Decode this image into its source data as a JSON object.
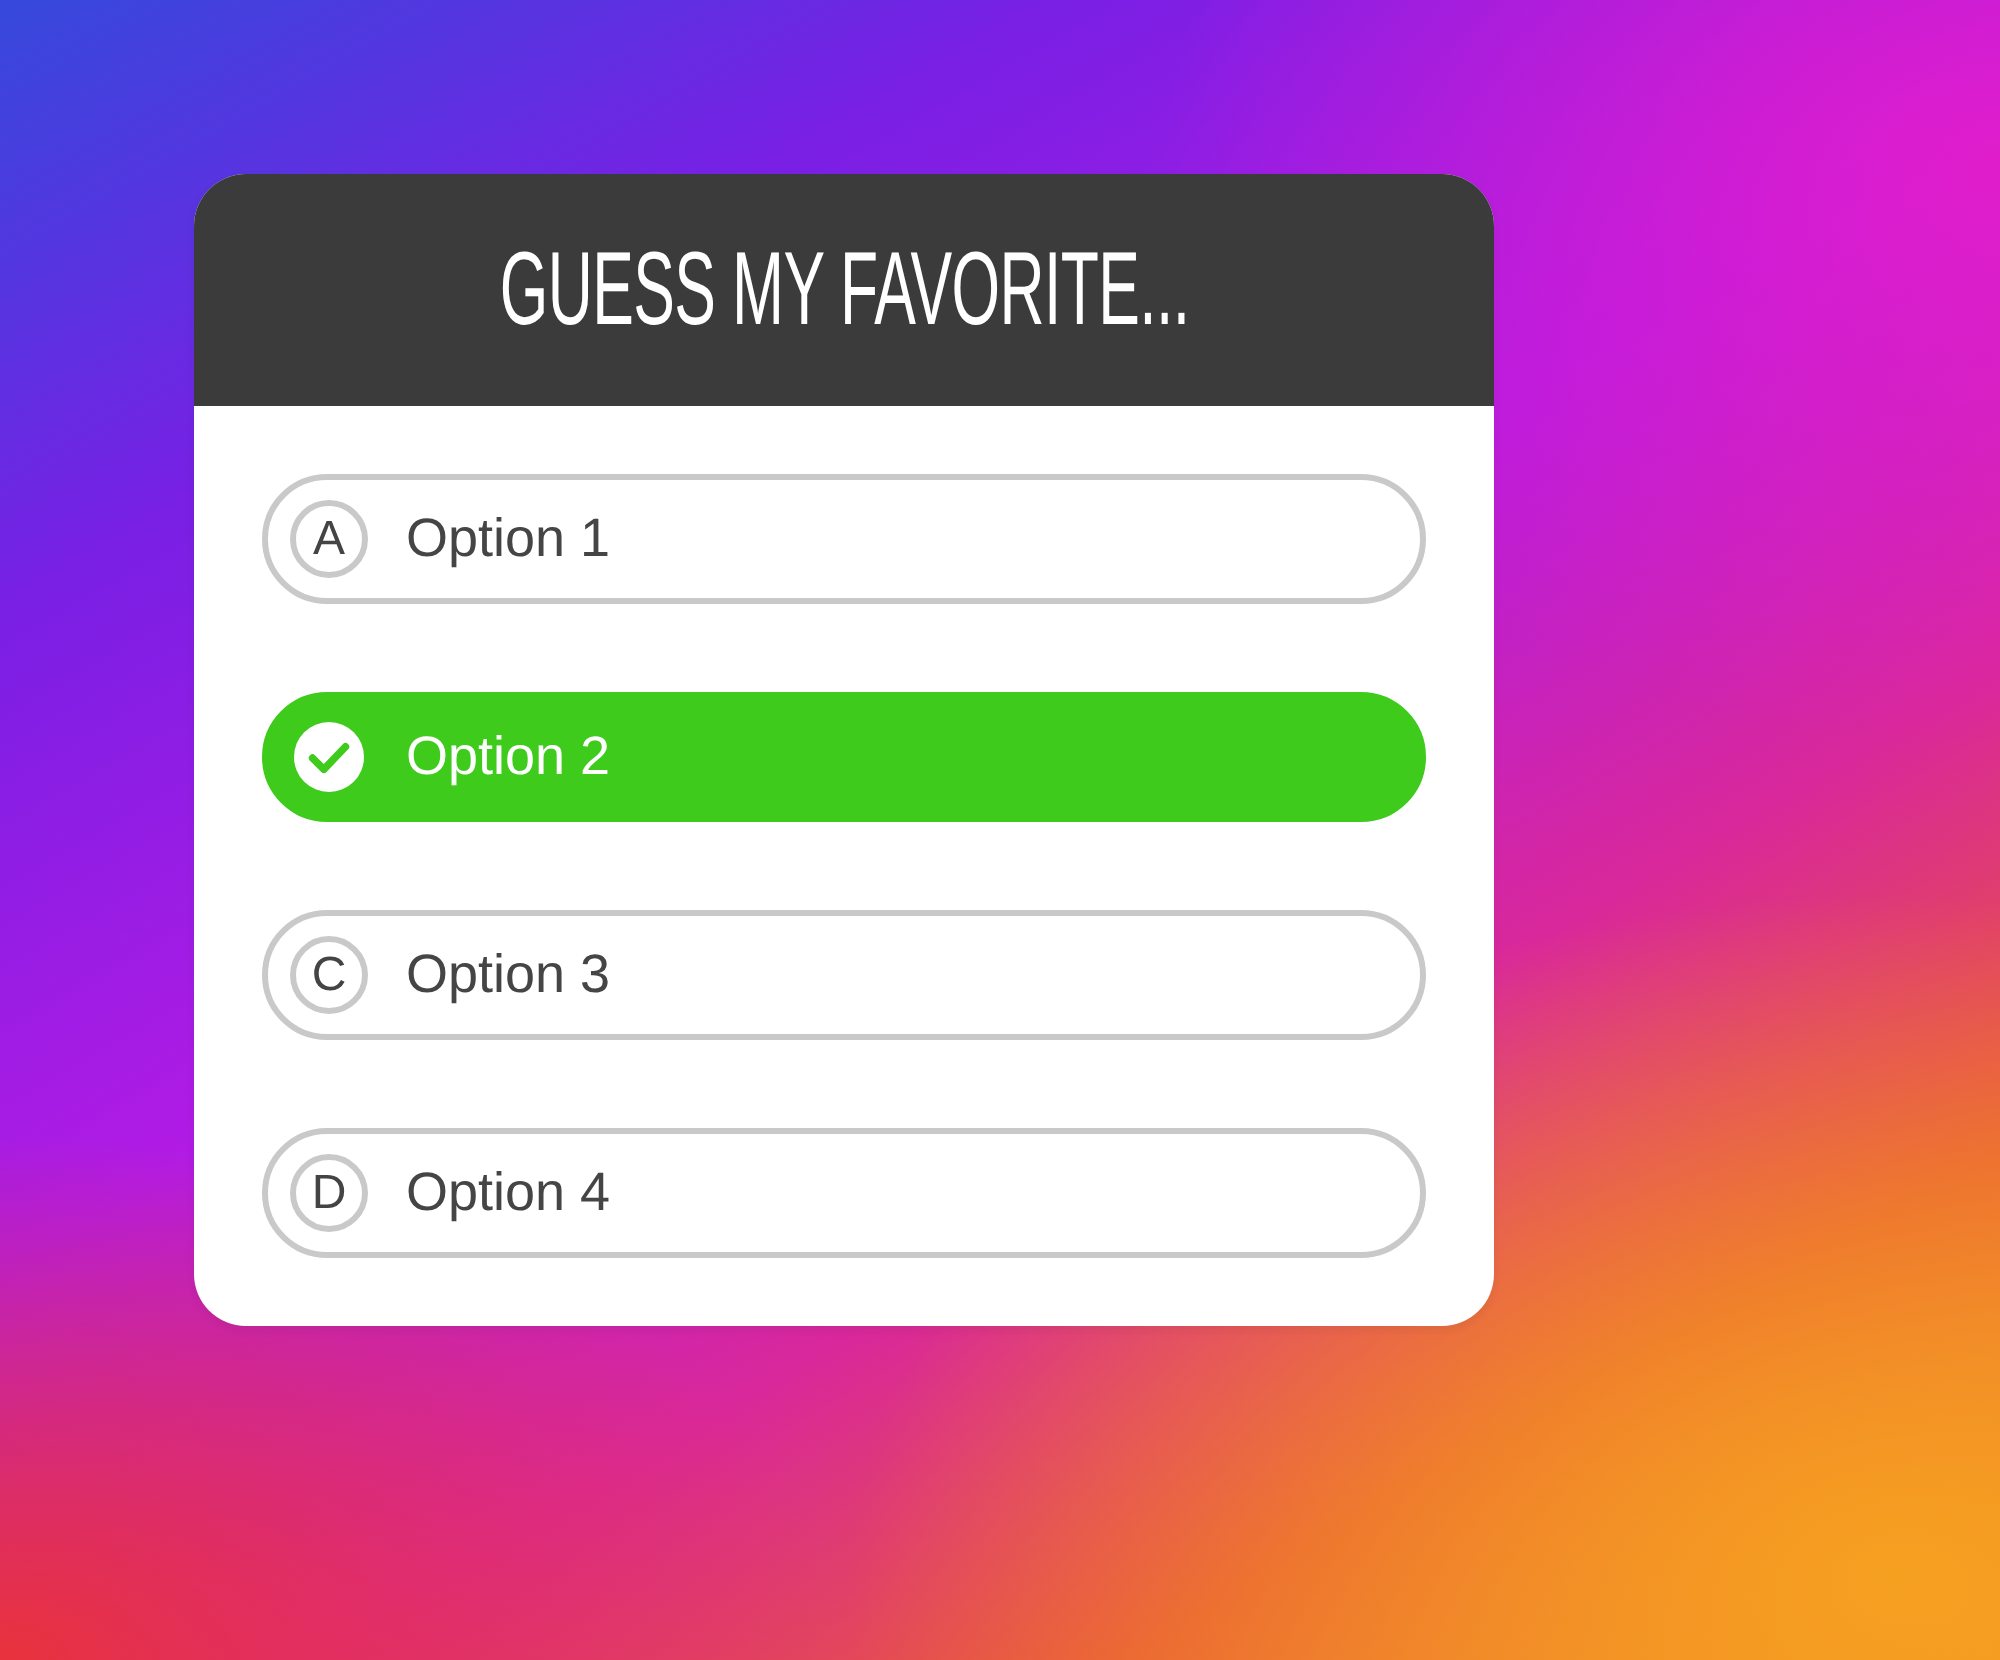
{
  "quiz": {
    "title": "GUESS MY FAVORITE...",
    "options": [
      {
        "letter": "A",
        "label": "Option 1",
        "selected": false
      },
      {
        "label": "Option 2",
        "selected": true
      },
      {
        "letter": "C",
        "label": "Option 3",
        "selected": false
      },
      {
        "letter": "D",
        "label": "Option 4",
        "selected": false
      }
    ]
  }
}
